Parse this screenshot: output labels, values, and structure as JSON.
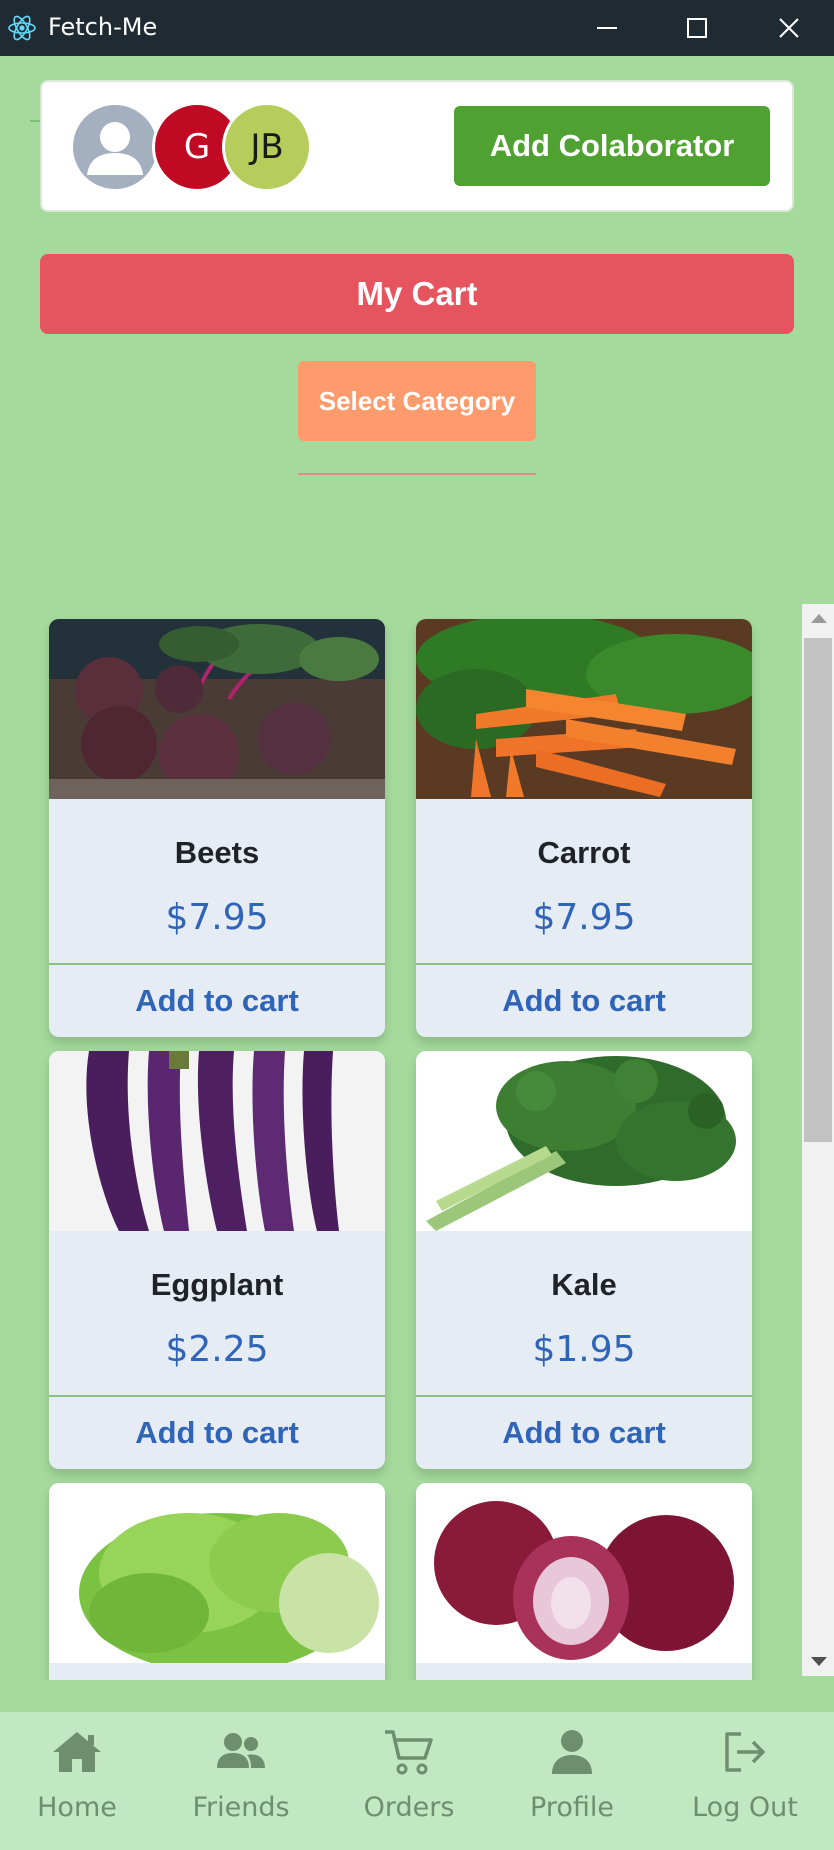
{
  "window": {
    "title": "Fetch-Me"
  },
  "collaborators": {
    "avatars": [
      {
        "kind": "user-icon",
        "color": "#a4afbf"
      },
      {
        "initials": "G",
        "color": "#c00a24"
      },
      {
        "initials": "JB",
        "color": "#b6cd5c"
      }
    ],
    "add_label": "Add Colaborator"
  },
  "cart": {
    "label": "My Cart"
  },
  "category": {
    "label": "Select Category"
  },
  "products": [
    {
      "name": "Beets",
      "price": "$7.95",
      "action": "Add to cart",
      "image": "beets-image"
    },
    {
      "name": "Carrot",
      "price": "$7.95",
      "action": "Add to cart",
      "image": "carrot-image"
    },
    {
      "name": "Eggplant",
      "price": "$2.25",
      "action": "Add to cart",
      "image": "eggplant-image"
    },
    {
      "name": "Kale",
      "price": "$1.95",
      "action": "Add to cart",
      "image": "kale-image"
    },
    {
      "name": "",
      "price": "",
      "action": "",
      "image": "lettuce-image"
    },
    {
      "name": "",
      "price": "",
      "action": "",
      "image": "red-onion-image"
    }
  ],
  "nav": {
    "items": [
      {
        "label": "Home",
        "icon": "home-icon"
      },
      {
        "label": "Friends",
        "icon": "friends-icon"
      },
      {
        "label": "Orders",
        "icon": "cart-icon"
      },
      {
        "label": "Profile",
        "icon": "profile-icon"
      },
      {
        "label": "Log Out",
        "icon": "logout-icon"
      }
    ]
  },
  "colors": {
    "background": "#a5da9c",
    "add_collaborator": "#4fa232",
    "my_cart": "#e5545f",
    "select_category": "#ff9a6c",
    "price_text": "#2f64b8",
    "nav_background": "#c2e8c1"
  }
}
